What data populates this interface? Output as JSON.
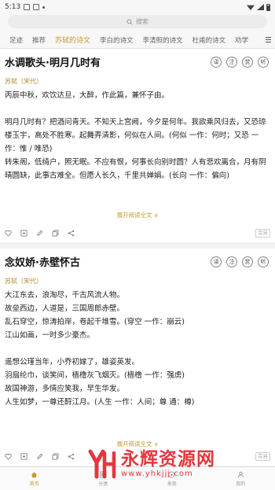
{
  "status_bar": {
    "time": "5:13"
  },
  "search": {
    "placeholder": "搜索"
  },
  "tabs": [
    "足迹",
    "推荐",
    "苏轼的诗文",
    "李白的诗文",
    "李清照的诗文",
    "杜甫的诗文",
    "劝学"
  ],
  "card_actions": [
    "译",
    "注",
    "赏",
    "听"
  ],
  "poems": [
    {
      "title": "水调歌头·明月几时有",
      "author": "苏轼〔宋代〕",
      "lines": [
        "丙辰中秋，欢饮达旦，大醉，作此篇，兼怀子由。",
        "",
        "明月几时有？把酒问青天。不知天上宫阙，今夕是何年。我欲乘风归去，又恐琼楼玉宇，高处不胜寒。起舞弄清影，何似在人间。(何似 一作：何时；又恐 一作：惟 / 唯恐)",
        "转朱阁，低绮户，照无眠。不应有恨，何事长向别时圆？人有悲欢离合，月有阴晴圆缺，此事古难全。但愿人长久，千里共婵娟。(长向 一作：偏向)"
      ],
      "expand_label": "展开阅读全文 ∨",
      "badge": "完另"
    },
    {
      "title": "念奴娇·赤壁怀古",
      "author": "苏轼〔宋代〕",
      "lines": [
        "大江东去，浪淘尽，千古风流人物。",
        "故垒西边，人道是，三国周郎赤壁。",
        "乱石穿空，惊涛拍岸，卷起千堆雪。(穿空 一作：崩云)",
        "江山如画，一时多少豪杰。",
        "",
        "遥想公瑾当年，小乔初嫁了，雄姿英发。",
        "羽扇纶巾，谈笑间，樯橹灰飞烟灭。(樯橹 一作：强虏)",
        "故国神游，多情应笑我，早生华发。",
        "人生如梦，一尊还酹江月。(人生 一作：人间；尊 通：樽)"
      ],
      "expand_label": "展开阅读全文 ∨",
      "badge": "完另"
    }
  ],
  "bottom_nav": [
    {
      "label": "首页",
      "icon": "home-icon"
    },
    {
      "label": "分类",
      "icon": "category-icon"
    },
    {
      "label": "发现",
      "icon": "discover-icon"
    },
    {
      "label": "我的",
      "icon": "user-icon"
    }
  ],
  "watermark": {
    "title": "永辉资源网",
    "url": "www.yhkjjj.com"
  },
  "colors": {
    "accent": "#c79a2e",
    "watermark": "#e3262e"
  }
}
